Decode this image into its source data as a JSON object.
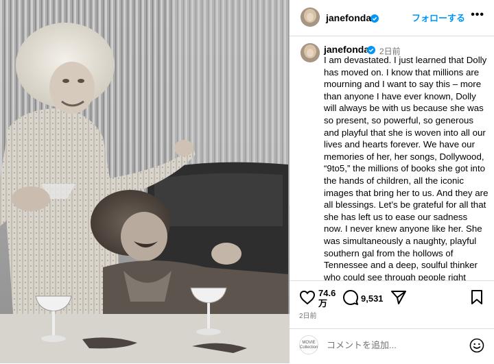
{
  "post": {
    "username": "jane​fonda",
    "follow_label": "フォローする",
    "more_label": "•••",
    "time_ago": "2日前",
    "caption": "I am devastated. I just learned that Dolly has moved on. I know that millions are mourning and I want to say this – more than anyone I have ever known, Dolly will always be with us because she was so present, so powerful, so generous and playful that she is woven into all our lives and hearts forever. We have our memories of her, her songs, Dollywood, “9to5,” the millions of books she got into the hands of children, all the iconic images that bring her to us. And they are\nall blessings. Let’s be grateful for all that she has left us to ease our sadness now. I never knew anyone like her. She was simultaneously a naughty, playful southern gal from the hollows of Tennessee and a deep, soulful thinker who could see through people right down to their true selves. She was many"
  },
  "actions": {
    "likes_line1": "74.6",
    "likes_line2": "万",
    "comments": "9,531",
    "date": "2日前"
  },
  "add_comment": {
    "placeholder": "コメントを追加...",
    "logo_text": "MOVIE Collection"
  },
  "icons": {
    "verified": "verified-badge-icon",
    "like": "heart-icon",
    "comment": "comment-bubble-icon",
    "share": "paper-plane-icon",
    "save": "bookmark-icon",
    "emoji": "smiley-icon"
  },
  "colors": {
    "accent": "#0095f6",
    "muted": "#737373",
    "border": "#dbdbdb"
  }
}
